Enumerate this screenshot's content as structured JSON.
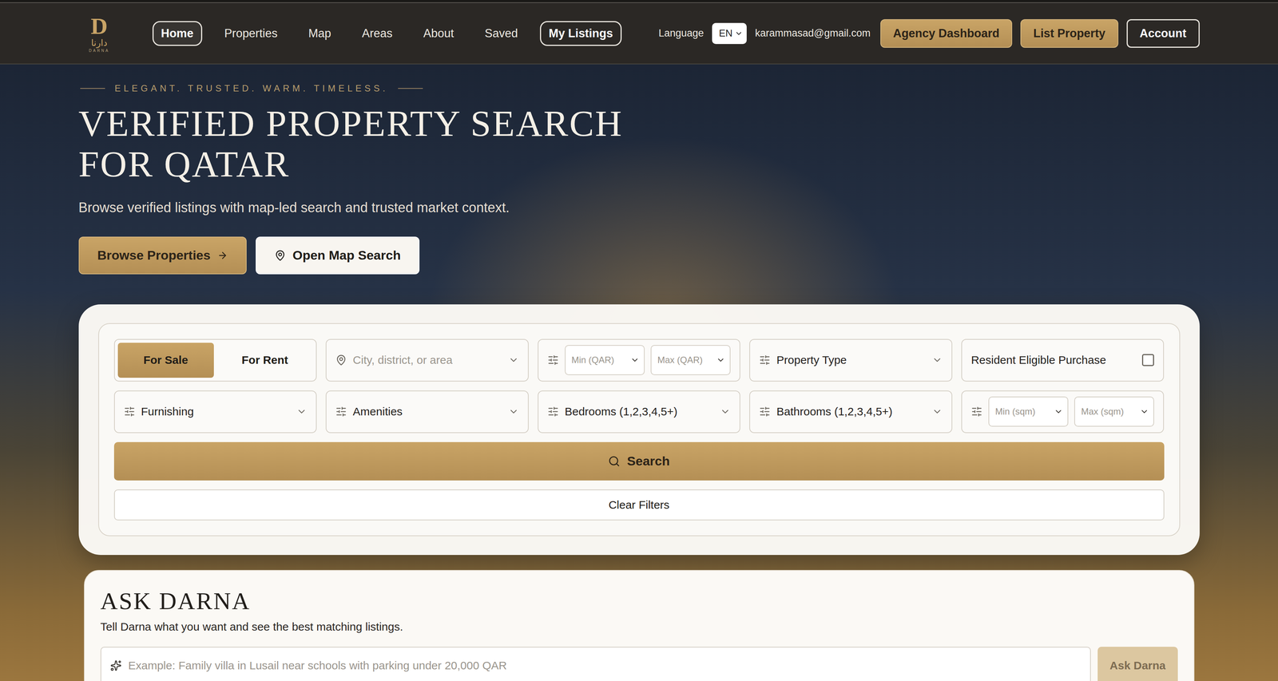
{
  "header": {
    "logo": {
      "mark": "D",
      "arabic": "دارنا",
      "latin": "DARNA"
    },
    "nav": [
      {
        "label": "Home",
        "kind": "pill",
        "selected": true
      },
      {
        "label": "Properties",
        "kind": "link",
        "selected": false
      },
      {
        "label": "Map",
        "kind": "link",
        "selected": false
      },
      {
        "label": "Areas",
        "kind": "link",
        "selected": false
      },
      {
        "label": "About",
        "kind": "link",
        "selected": false
      },
      {
        "label": "Saved",
        "kind": "link",
        "selected": false
      },
      {
        "label": "My Listings",
        "kind": "pill",
        "selected": false
      }
    ],
    "language": {
      "label": "Language",
      "value": "EN"
    },
    "email": "karammasad@gmail.com",
    "actions": [
      {
        "label": "Agency Dashboard",
        "kind": "gold"
      },
      {
        "label": "List Property",
        "kind": "gold"
      },
      {
        "label": "Account",
        "kind": "outline"
      }
    ]
  },
  "hero": {
    "tagline": "ELEGANT. TRUSTED. WARM. TIMELESS.",
    "title_lines": [
      "VERIFIED PROPERTY SEARCH",
      "FOR QATAR"
    ],
    "subtitle": "Browse verified listings with map-led search and trusted market context.",
    "buttons": [
      {
        "label": "Browse Properties",
        "kind": "gold"
      },
      {
        "label": "Open Map Search",
        "kind": "light"
      }
    ]
  },
  "search": {
    "modes": [
      {
        "label": "For Sale",
        "selected": true
      },
      {
        "label": "For Rent",
        "selected": false
      }
    ],
    "location": {
      "placeholder": "City, district, or area"
    },
    "price": {
      "min": "Min (QAR)",
      "max": "Max (QAR)"
    },
    "property_type": "Property Type",
    "resident_eligible": {
      "label": "Resident Eligible Purchase",
      "checked": false
    },
    "furnishing": "Furnishing",
    "amenities": "Amenities",
    "bedrooms": "Bedrooms (1,2,3,4,5+)",
    "bathrooms": "Bathrooms (1,2,3,4,5+)",
    "area": {
      "min": "Min (sqm)",
      "max": "Max (sqm)"
    },
    "search_button": "Search",
    "clear_button": "Clear Filters"
  },
  "ask": {
    "title": "ASK DARNA",
    "subtitle": "Tell Darna what you want and see the best matching listings.",
    "placeholder": "Example: Family villa in Lusail near schools with parking under 20,000 QAR",
    "button": {
      "label": "Ask Darna",
      "disabled": true
    }
  }
}
